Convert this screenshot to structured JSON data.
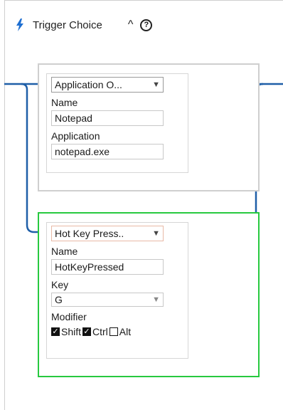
{
  "header": {
    "title": "Trigger Choice",
    "collapse_glyph": "^",
    "help_glyph": "?",
    "icon": "bolt-icon"
  },
  "colors": {
    "wire": "#1f5fa8",
    "accent_bolt": "#1f6fd1",
    "selected_border": "#27c93f",
    "card_border": "#cfcfcf"
  },
  "triggers": [
    {
      "type_label": "Application O...",
      "name_label": "Name",
      "name_value": "Notepad",
      "app_label": "Application",
      "app_value": "notepad.exe",
      "caret": "▼"
    },
    {
      "type_label": "Hot Key Press..",
      "name_label": "Name",
      "name_value": "HotKeyPressed",
      "key_label": "Key",
      "key_value": "G",
      "modifier_label": "Modifier",
      "caret": "▼",
      "modifiers": [
        {
          "label": "Shift",
          "checked": true
        },
        {
          "label": "Ctrl",
          "checked": true
        },
        {
          "label": "Alt",
          "checked": false
        }
      ]
    }
  ]
}
